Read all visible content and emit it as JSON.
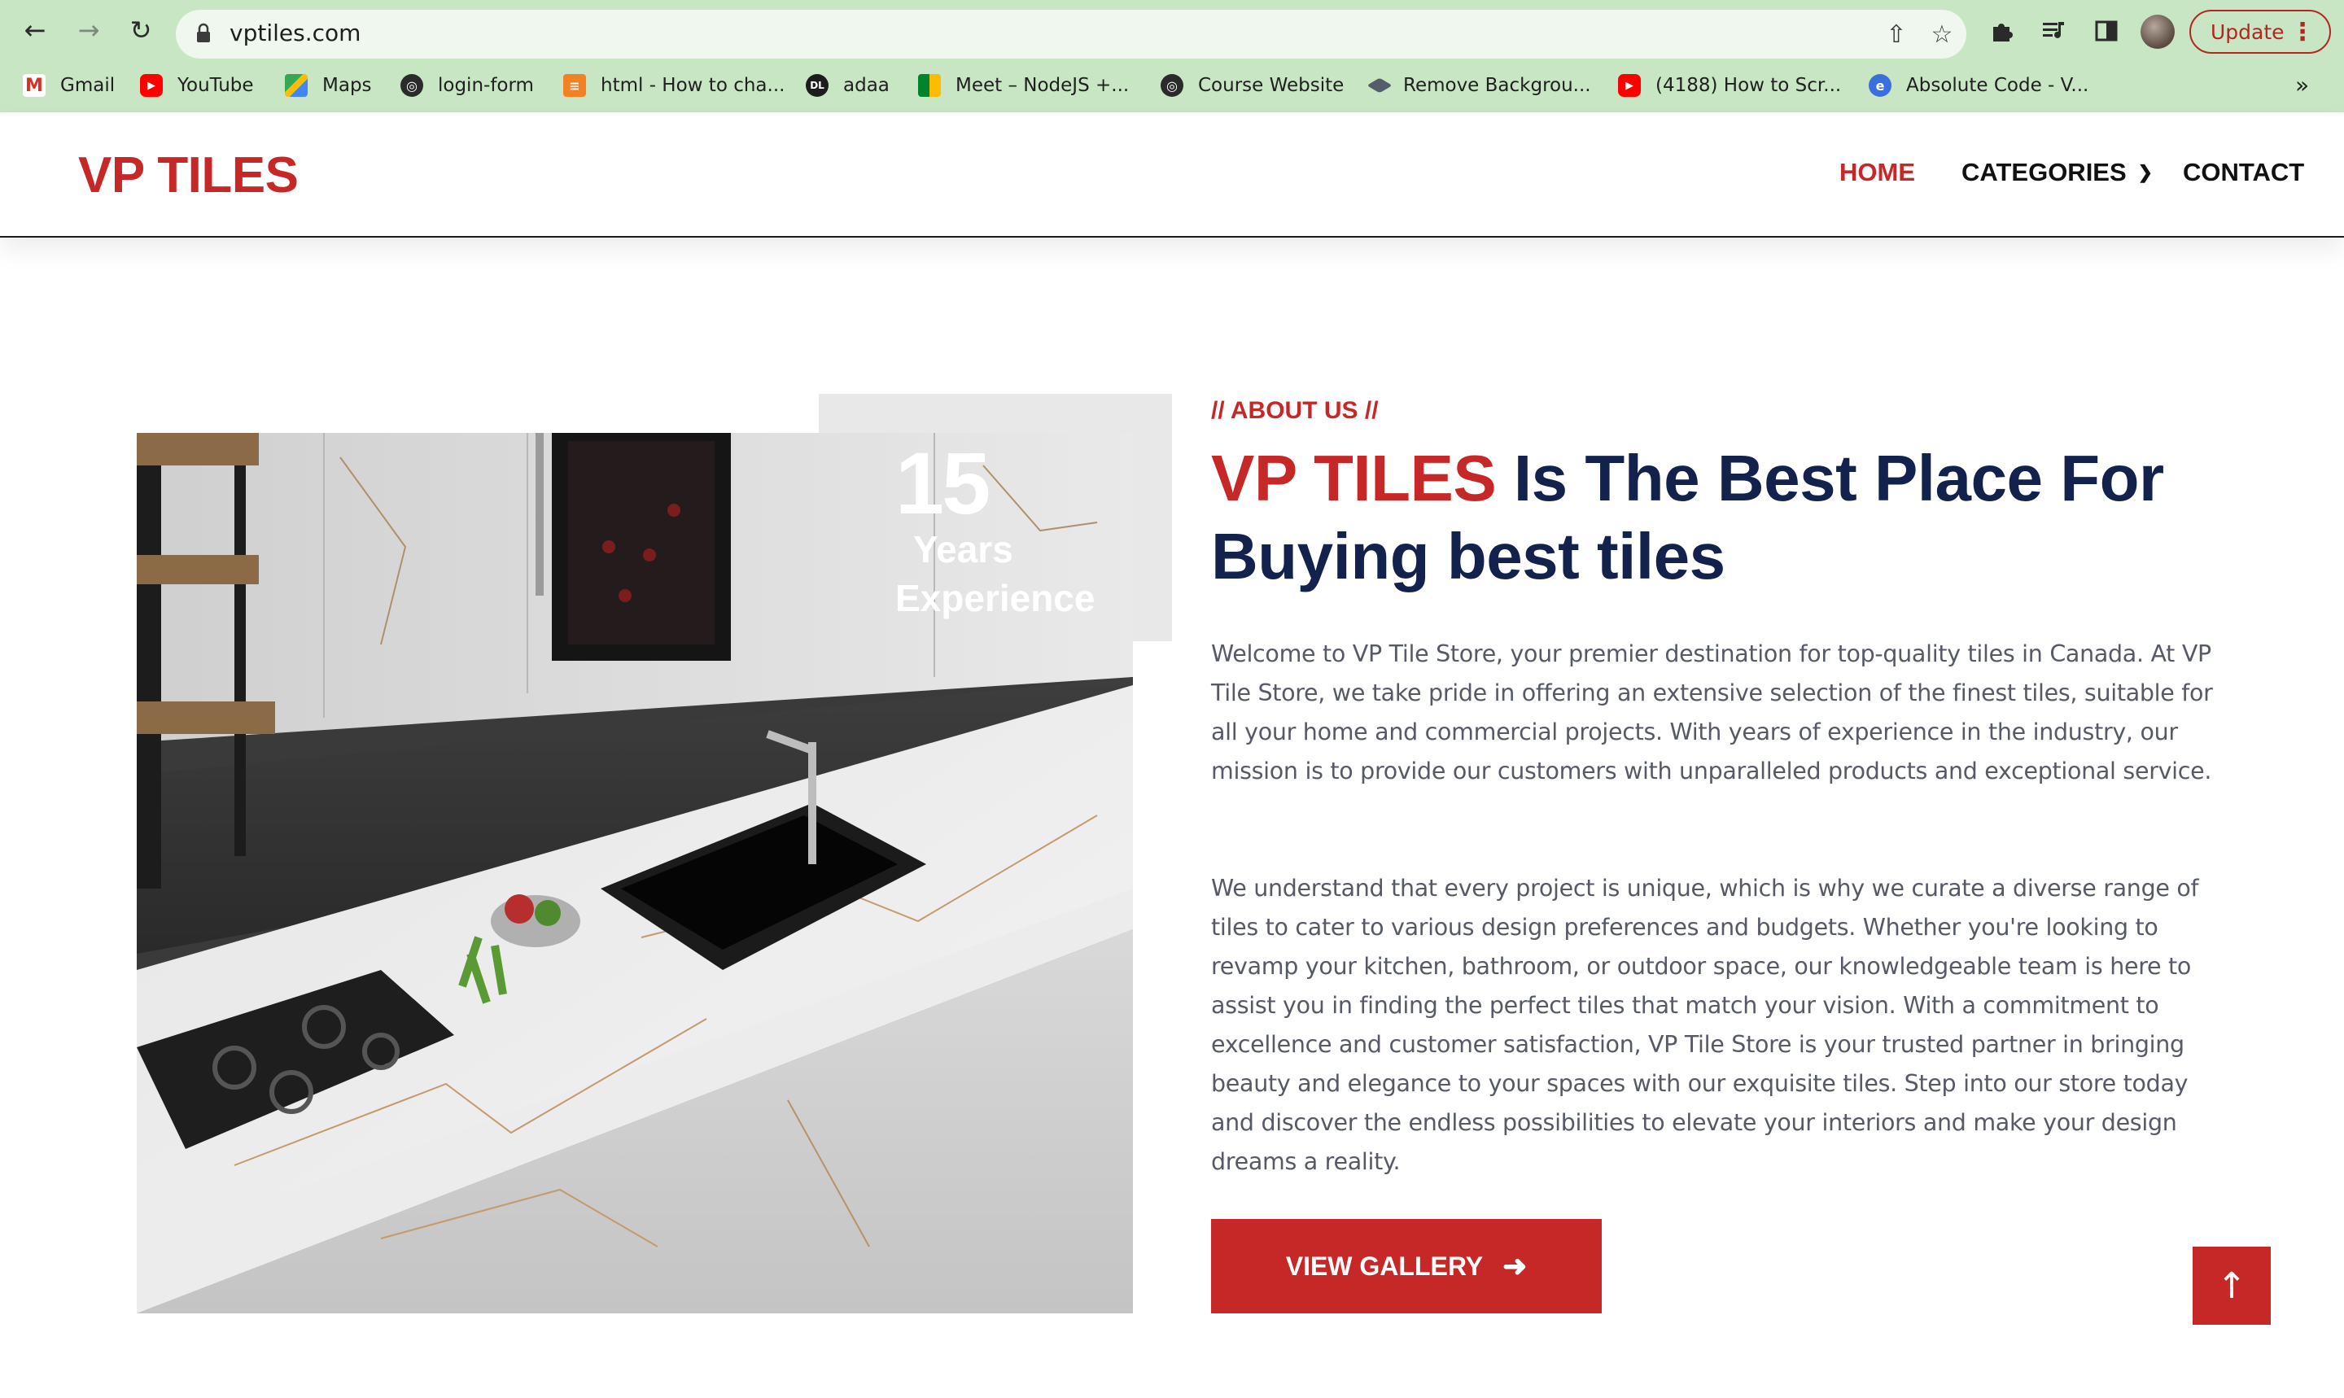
{
  "browser": {
    "url": "vptiles.com",
    "update_label": "Update",
    "bookmarks": [
      {
        "label": "Gmail",
        "icon": "gmail-icon"
      },
      {
        "label": "YouTube",
        "icon": "youtube-icon"
      },
      {
        "label": "Maps",
        "icon": "maps-icon"
      },
      {
        "label": "login-form",
        "icon": "globe-icon"
      },
      {
        "label": "html - How to cha...",
        "icon": "stackoverflow-icon"
      },
      {
        "label": "adaa",
        "icon": "dl-icon"
      },
      {
        "label": "Meet – NodeJS +...",
        "icon": "meet-icon"
      },
      {
        "label": "Course Website",
        "icon": "globe-icon"
      },
      {
        "label": "Remove Backgrou...",
        "icon": "removebg-icon"
      },
      {
        "label": "(4188) How to Scr...",
        "icon": "youtube-icon"
      },
      {
        "label": "Absolute Code - V...",
        "icon": "edge-icon"
      }
    ]
  },
  "site": {
    "logo": "VP TILES",
    "nav": [
      {
        "label": "HOME",
        "active": true
      },
      {
        "label": "CATEGORIES",
        "active": false
      },
      {
        "label": "CONTACT",
        "active": false
      }
    ]
  },
  "about": {
    "experience_number": "15",
    "experience_years": "Years",
    "experience_label": "Experience",
    "eyebrow": "// ABOUT US //",
    "heading_brand": "VP TILES",
    "heading_rest_line1": " Is The Best Place For",
    "heading_line2": "Buying best tiles",
    "paragraph1": "Welcome to VP Tile Store, your premier destination for top-quality tiles in Canada. At VP Tile Store, we take pride in offering an extensive selection of the finest tiles, suitable for all your home and commercial projects. With years of experience in the industry, our mission is to provide our customers with unparalleled products and exceptional service.",
    "paragraph2": "We understand that every project is unique, which is why we curate a diverse range of tiles to cater to various design preferences and budgets. Whether you're looking to revamp your kitchen, bathroom, or outdoor space, our knowledgeable team is here to assist you in finding the perfect tiles that match your vision. With a commitment to excellence and customer satisfaction, VP Tile Store is your trusted partner in bringing beauty and elegance to your spaces with our exquisite tiles. Step into our store today and discover the endless possibilities to elevate your interiors and make your design dreams a reality.",
    "cta_label": "VIEW GALLERY"
  },
  "colors": {
    "brand_red": "#c62828",
    "heading_navy": "#13214d",
    "body_text": "#555a66",
    "chrome_green": "#c8e6c4"
  }
}
